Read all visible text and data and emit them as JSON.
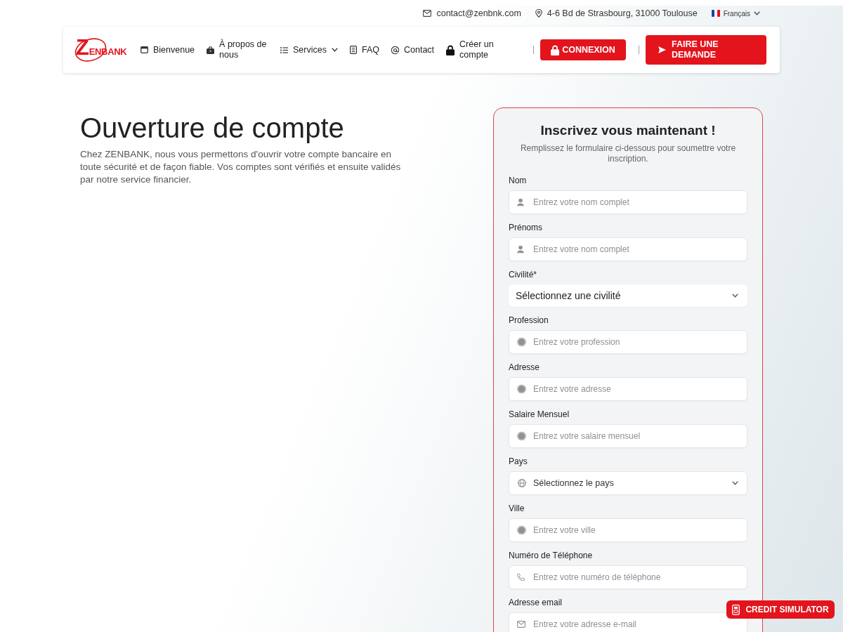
{
  "top_bar": {
    "email": "contact@zenbnk.com",
    "address": "4-6 Bd de Strasbourg, 31000 Toulouse",
    "language": "Français"
  },
  "nav": {
    "logo": "ZENBANK",
    "items": [
      {
        "label": "Bienvenue",
        "kind": "link"
      },
      {
        "label": "À propos de nous",
        "kind": "link"
      },
      {
        "label": "Services",
        "kind": "menu"
      },
      {
        "label": "FAQ",
        "kind": "link"
      },
      {
        "label": "Contact",
        "kind": "link"
      },
      {
        "label": "Créer un compte",
        "kind": "link"
      }
    ],
    "buttons": [
      {
        "label": "CONNEXION"
      },
      {
        "label": "FAIRE UNE DEMANDE"
      }
    ]
  },
  "hero": {
    "title": "Ouverture de compte",
    "text": "Chez ZENBANK, nous vous permettons d'ouvrir votre compte bancaire en toute sécurité et de façon fiable. Vos comptes sont vérifiés et ensuite validés par notre service financier."
  },
  "form": {
    "title": "Inscrivez vous maintenant !",
    "subtitle": "Remplissez le formulaire ci-dessous pour soumettre votre inscription.",
    "fields": [
      {
        "label": "Nom",
        "kind": "text",
        "placeholder": "Entrez votre nom complet"
      },
      {
        "label": "Prénoms",
        "kind": "text",
        "placeholder": "Entrez votre nom complet"
      },
      {
        "label": "Civilité*",
        "kind": "select",
        "value": "Sélectionnez une civilité"
      },
      {
        "label": "Profession",
        "kind": "text",
        "placeholder": "Entrez votre profession"
      },
      {
        "label": "Adresse",
        "kind": "text",
        "placeholder": "Entrez votre adresse"
      },
      {
        "label": "Salaire Mensuel",
        "kind": "text",
        "placeholder": "Entrez votre salaire mensuel"
      },
      {
        "label": "Pays",
        "kind": "select",
        "value": "Sélectionnez le pays"
      },
      {
        "label": "Ville",
        "kind": "text",
        "placeholder": "Entrez votre ville"
      },
      {
        "label": "Numéro de Téléphone",
        "kind": "text",
        "placeholder": "Entrez votre numéro de téléphone"
      },
      {
        "label": "Adresse email",
        "kind": "text",
        "placeholder": "Entrez votre adresse e-mail"
      }
    ]
  },
  "credit_simulator": {
    "label": "CREDIT SIMULATOR"
  }
}
